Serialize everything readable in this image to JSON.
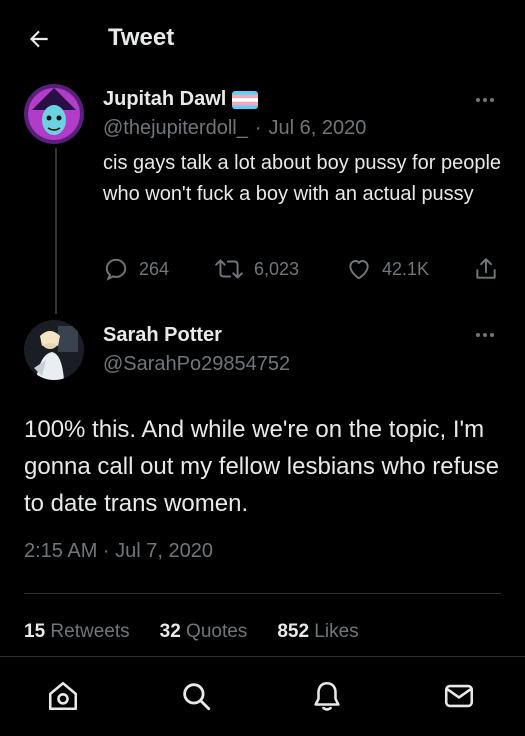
{
  "header": {
    "title": "Tweet",
    "back_icon": "back-arrow-icon"
  },
  "parent_tweet": {
    "author_name": "Jupitah Dawl",
    "flag_icon": "trans-flag-icon",
    "handle": "@thejupiterdoll_",
    "separator": "·",
    "date": "Jul 6, 2020",
    "text": "cis gays talk a lot about boy pussy for people who won't fuck a boy with an actual pussy",
    "replies": "264",
    "retweets": "6,023",
    "likes": "42.1K"
  },
  "main_tweet": {
    "author_name": "Sarah Potter",
    "handle": "@SarahPo29854752",
    "text": "100% this. And while we're on the topic, I'm gonna call out my fellow lesbians who refuse to date trans women.",
    "timestamp": "2:15 AM · Jul 7, 2020"
  },
  "stats": {
    "retweets_count": "15",
    "retweets_label": "Retweets",
    "quotes_count": "32",
    "quotes_label": "Quotes",
    "likes_count": "852",
    "likes_label": "Likes"
  },
  "nav": [
    "home-icon",
    "search-icon",
    "notifications-icon",
    "messages-icon"
  ],
  "colors": {
    "background": "#000000",
    "text": "#e7e9ea",
    "muted": "#71767b",
    "divider": "#2f3336"
  }
}
